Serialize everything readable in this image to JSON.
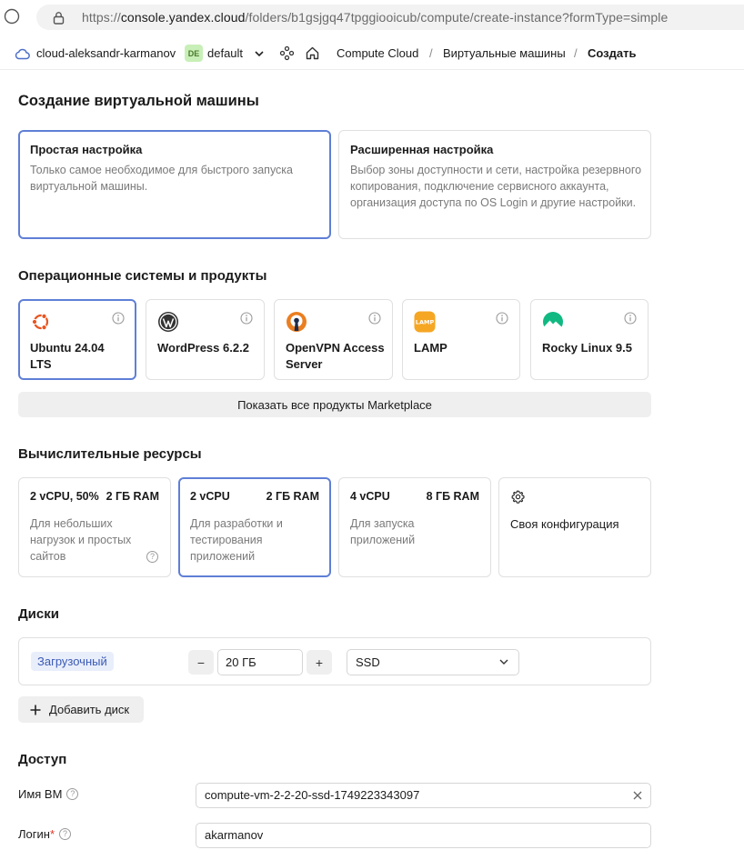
{
  "browser": {
    "url_scheme": "https://",
    "url_host": "console.yandex.cloud",
    "url_rest": "/folders/b1gsjgq47tpggiooicub/compute/create-instance?formType=simple"
  },
  "header": {
    "cloud_name": "cloud-aleksandr-karmanov",
    "folder_badge": "DE",
    "folder_name": "default",
    "crumbs": [
      "Compute Cloud",
      "Виртуальные машины",
      "Создать"
    ],
    "separator": "/"
  },
  "page": {
    "title": "Создание виртуальной машины"
  },
  "setup_modes": [
    {
      "title": "Простая настройка",
      "desc": "Только самое необходимое для быстрого запуска виртуальной машины.",
      "selected": true
    },
    {
      "title": "Расширенная настройка",
      "desc": "Выбор зоны доступности и сети, настройка резервного копирования, подключение сервисного аккаунта, организация доступа по OS Login и другие настройки.",
      "selected": false
    }
  ],
  "os_section": {
    "heading": "Операционные системы и продукты",
    "items": [
      {
        "name": "Ubuntu 24.04 LTS",
        "icon": "ubuntu-icon",
        "selected": true
      },
      {
        "name": "WordPress 6.2.2",
        "icon": "wordpress-icon",
        "selected": false
      },
      {
        "name": "OpenVPN Access Server",
        "icon": "openvpn-icon",
        "selected": false
      },
      {
        "name": "LAMP",
        "icon": "lamp-icon",
        "selected": false
      },
      {
        "name": "Rocky Linux 9.5",
        "icon": "rocky-linux-icon",
        "selected": false
      }
    ],
    "marketplace_label": "Показать все продукты Marketplace",
    "lamp_icon_text": "LAMP"
  },
  "resources": {
    "heading": "Вычислительные ресурсы",
    "presets": [
      {
        "cpu": "2 vCPU, 50%",
        "ram": "2 ГБ RAM",
        "desc": "Для небольших нагрузок и простых сайтов",
        "selected": false
      },
      {
        "cpu": "2 vCPU",
        "ram": "2 ГБ RAM",
        "desc": "Для разработки и тестирования приложений",
        "selected": true
      },
      {
        "cpu": "4 vCPU",
        "ram": "8 ГБ RAM",
        "desc": "Для запуска приложений",
        "selected": false
      }
    ],
    "custom_label": "Своя конфигурация",
    "help_glyph": "?"
  },
  "disks": {
    "heading": "Диски",
    "boot_label": "Загрузочный",
    "decrement": "−",
    "increment": "+",
    "size_value": "20 ГБ",
    "type_value": "SSD",
    "add_label": "Добавить диск"
  },
  "access": {
    "heading": "Доступ",
    "vm_name_label": "Имя ВМ",
    "vm_name_value": "compute-vm-2-2-20-ssd-1749223343097",
    "login_label": "Логин",
    "required_mark": "*",
    "login_value": "akarmanov"
  },
  "colors": {
    "accent": "#5f7fd6",
    "ubuntu": "#e95420",
    "lamp": "#f5a623",
    "rocky": "#10b981"
  }
}
